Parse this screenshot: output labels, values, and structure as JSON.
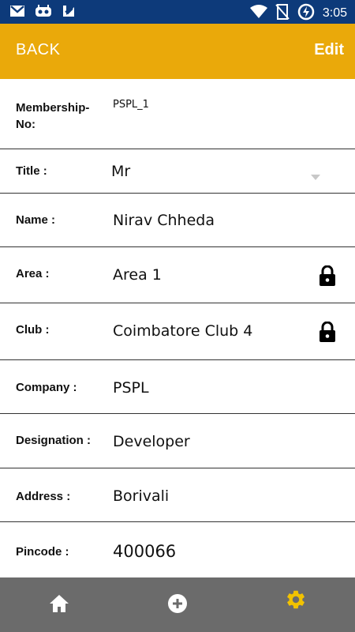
{
  "status_bar": {
    "time": "3:05"
  },
  "app_bar": {
    "back_label": "BACK",
    "edit_label": "Edit"
  },
  "form": {
    "membership": {
      "label": "Membership-\nNo:",
      "value": "PSPL_1"
    },
    "title": {
      "label": "Title :",
      "value": "Mr"
    },
    "name": {
      "label": "Name :",
      "value": "Nirav Chheda"
    },
    "area": {
      "label": "Area :",
      "value": "Area 1"
    },
    "club": {
      "label": "Club :",
      "value": "Coimbatore Club 4"
    },
    "company": {
      "label": "Company :",
      "value": "PSPL"
    },
    "designation": {
      "label": "Designation :",
      "value": "Developer"
    },
    "address": {
      "label": "Address :",
      "value": "Borivali"
    },
    "pincode": {
      "label": "Pincode :",
      "value": "400066"
    }
  },
  "bottom_nav": {
    "items": [
      {
        "icon": "home-icon"
      },
      {
        "icon": "add-circle-icon"
      },
      {
        "icon": "settings-gear-icon"
      }
    ],
    "active_color": "#f2c200"
  },
  "colors": {
    "status_bar": "#0d3a7a",
    "app_bar": "#eaa90a",
    "bottom_nav": "#6b6b6b"
  }
}
